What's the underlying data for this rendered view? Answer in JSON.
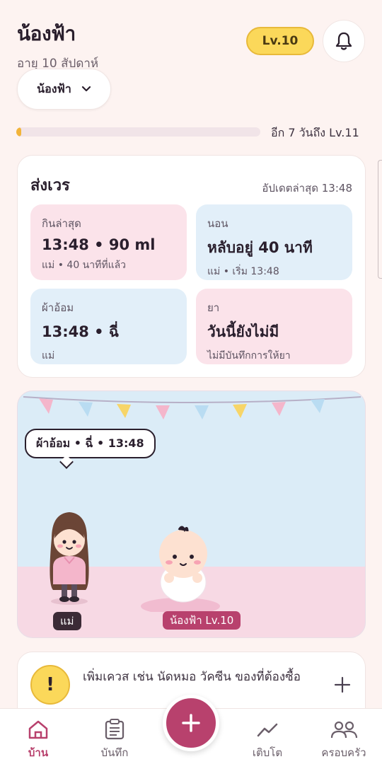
{
  "header": {
    "baby_name": "น้องฟ้า",
    "age": "อายุ 10 สัปดาห์",
    "selector_label": "น้องฟ้า",
    "level_badge": "Lv.10"
  },
  "progress": {
    "value": 0.02,
    "text": "อีก 7 วันถึง Lv.11"
  },
  "shift_card": {
    "title": "ส่งเวร",
    "updated": "อัปเดตล่าสุด 13:48",
    "tiles": [
      {
        "label": "กินล่าสุด",
        "value": "13:48 • 90 ml",
        "sub": "แม่ • 40 นาทีที่แล้ว",
        "color": "#fbe3ea"
      },
      {
        "label": "นอน",
        "value": "หลับอยู่ 40 นาที",
        "sub": "แม่ • เริ่ม 13:48",
        "color": "#e2eff9"
      },
      {
        "label": "ผ้าอ้อม",
        "value": "13:48 • ฉี่",
        "sub": "แม่",
        "color": "#e2eff9"
      },
      {
        "label": "ยา",
        "value": "วันนี้ยังไม่มี",
        "sub": "ไม่มีบันทึกการให้ยา",
        "color": "#fbe3ea"
      }
    ]
  },
  "scene": {
    "bubble": "ผ้าอ้อม • ฉี่ • 13:48",
    "mom_tag": "แม่",
    "baby_tag": "น้องฟ้า Lv.10"
  },
  "quest": {
    "text": "เพิ่มเควส เช่น นัดหมอ วัคซีน ของที่ต้องซื้อ",
    "icon": "exclamation-icon"
  },
  "tabbar": {
    "items": [
      {
        "label": "บ้าน",
        "icon": "home-icon",
        "active": true
      },
      {
        "label": "บันทึก",
        "icon": "clipboard-icon",
        "active": false
      },
      {
        "label": "เติบโต",
        "icon": "trend-icon",
        "active": false
      },
      {
        "label": "ครอบครัว",
        "icon": "family-icon",
        "active": false
      }
    ]
  },
  "colors": {
    "accent": "#b8416d",
    "gold": "#fbd85a",
    "background": "#fdf3f1"
  }
}
